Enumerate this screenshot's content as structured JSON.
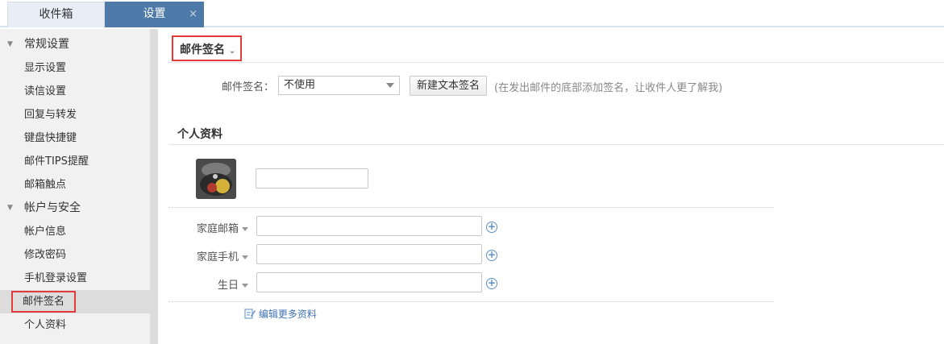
{
  "tabs": [
    {
      "label": "收件箱"
    },
    {
      "label": "设置",
      "close": "×"
    }
  ],
  "sidebar": {
    "groups": [
      {
        "label": "常规设置",
        "items": [
          {
            "label": "显示设置"
          },
          {
            "label": "读信设置"
          },
          {
            "label": "回复与转发"
          },
          {
            "label": "键盘快捷键"
          },
          {
            "label": "邮件TIPS提醒"
          },
          {
            "label": "邮箱触点"
          }
        ]
      },
      {
        "label": "帐户与安全",
        "items": [
          {
            "label": "帐户信息"
          },
          {
            "label": "修改密码"
          },
          {
            "label": "手机登录设置"
          },
          {
            "label": "邮件签名"
          },
          {
            "label": "个人资料"
          }
        ]
      }
    ]
  },
  "signature": {
    "title": "邮件签名",
    "label": "邮件签名：",
    "selected": "不使用",
    "new_button": "新建文本签名",
    "hint": "(在发出邮件的底部添加签名，让收件人更了解我)"
  },
  "profile": {
    "title": "个人资料",
    "fields": [
      {
        "label": "家庭邮箱",
        "value": ""
      },
      {
        "label": "家庭手机",
        "value": ""
      },
      {
        "label": "生日",
        "value": ""
      }
    ],
    "more_link": "编辑更多资料"
  },
  "colors": {
    "accent": "#4d7aa8",
    "highlight_border": "#e23b3b",
    "link": "#3f73b5"
  }
}
